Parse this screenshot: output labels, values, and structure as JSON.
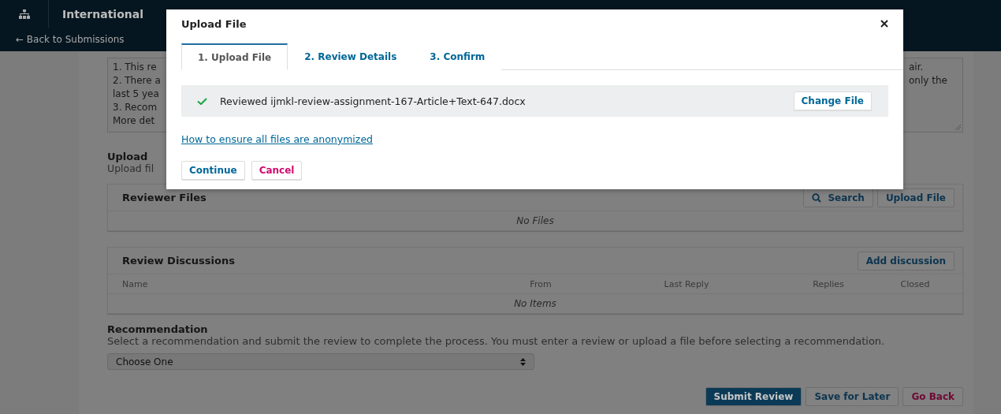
{
  "header": {
    "title": "International",
    "back_link": "← Back to Submissions"
  },
  "review_text": {
    "left_lines": [
      "1. This re",
      "2. There a",
      "last 5 yea",
      "3. Recom",
      "More det"
    ],
    "right_lines": [
      "air.",
      "only the"
    ]
  },
  "upload": {
    "title": "Upload",
    "description": "Upload fil"
  },
  "reviewer_files": {
    "title": "Reviewer Files",
    "buttons": [
      {
        "label": "Search",
        "kind": "search"
      },
      {
        "label": "Upload File",
        "kind": "plain"
      }
    ],
    "empty": "No Files"
  },
  "review_discussions": {
    "title": "Review Discussions",
    "button": "Add discussion",
    "columns": [
      "Name",
      "From",
      "Last Reply",
      "Replies",
      "Closed"
    ],
    "empty": "No Items"
  },
  "recommendation": {
    "title": "Recommendation",
    "description": "Select a recommendation and submit the review to complete the process. You must enter a review or upload a file before selecting a recommendation.",
    "select": "Choose One"
  },
  "actions": [
    {
      "label": "Submit Review",
      "kind": "primary"
    },
    {
      "label": "Save for Later",
      "kind": "default"
    },
    {
      "label": "Go Back",
      "kind": "danger"
    }
  ],
  "modal": {
    "title": "Upload File",
    "tabs": [
      {
        "label": "1. Upload File",
        "selected": true
      },
      {
        "label": "2. Review Details",
        "selected": false
      },
      {
        "label": "3. Confirm",
        "selected": false
      }
    ],
    "file": {
      "name": "Reviewed ijmkl-review-assignment-167-Article+Text-647.docx",
      "button": "Change File"
    },
    "link": "How to ensure all files are anonymized",
    "buttons": [
      {
        "label": "Continue",
        "kind": "primary"
      },
      {
        "label": "Cancel",
        "kind": "danger"
      }
    ]
  }
}
